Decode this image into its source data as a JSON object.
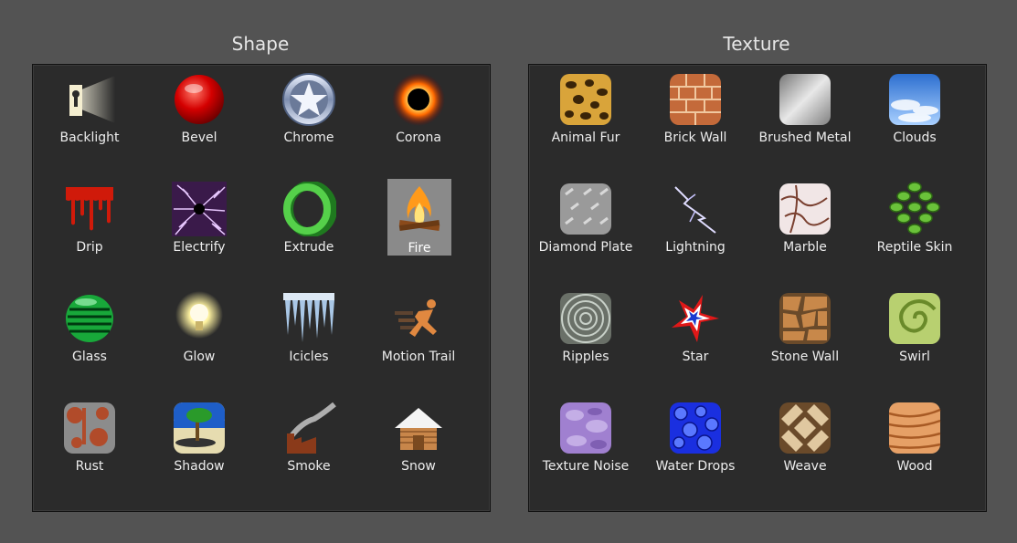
{
  "shape": {
    "title": "Shape",
    "items": [
      {
        "label": "Backlight",
        "icon": "backlight-icon"
      },
      {
        "label": "Bevel",
        "icon": "bevel-icon"
      },
      {
        "label": "Chrome",
        "icon": "chrome-icon"
      },
      {
        "label": "Corona",
        "icon": "corona-icon"
      },
      {
        "label": "Drip",
        "icon": "drip-icon"
      },
      {
        "label": "Electrify",
        "icon": "electrify-icon"
      },
      {
        "label": "Extrude",
        "icon": "extrude-icon"
      },
      {
        "label": "Fire",
        "icon": "fire-icon",
        "selected": true
      },
      {
        "label": "Glass",
        "icon": "glass-icon"
      },
      {
        "label": "Glow",
        "icon": "glow-icon"
      },
      {
        "label": "Icicles",
        "icon": "icicles-icon"
      },
      {
        "label": "Motion Trail",
        "icon": "motion-trail-icon"
      },
      {
        "label": "Rust",
        "icon": "rust-icon"
      },
      {
        "label": "Shadow",
        "icon": "shadow-icon"
      },
      {
        "label": "Smoke",
        "icon": "smoke-icon"
      },
      {
        "label": "Snow",
        "icon": "snow-icon"
      }
    ]
  },
  "texture": {
    "title": "Texture",
    "items": [
      {
        "label": "Animal Fur",
        "icon": "animal-fur-icon"
      },
      {
        "label": "Brick Wall",
        "icon": "brick-wall-icon"
      },
      {
        "label": "Brushed Metal",
        "icon": "brushed-metal-icon"
      },
      {
        "label": "Clouds",
        "icon": "clouds-icon"
      },
      {
        "label": "Diamond Plate",
        "icon": "diamond-plate-icon"
      },
      {
        "label": "Lightning",
        "icon": "lightning-icon"
      },
      {
        "label": "Marble",
        "icon": "marble-icon"
      },
      {
        "label": "Reptile Skin",
        "icon": "reptile-skin-icon"
      },
      {
        "label": "Ripples",
        "icon": "ripples-icon"
      },
      {
        "label": "Star",
        "icon": "star-icon"
      },
      {
        "label": "Stone Wall",
        "icon": "stone-wall-icon"
      },
      {
        "label": "Swirl",
        "icon": "swirl-icon"
      },
      {
        "label": "Texture Noise",
        "icon": "texture-noise-icon"
      },
      {
        "label": "Water Drops",
        "icon": "water-drops-icon"
      },
      {
        "label": "Weave",
        "icon": "weave-icon"
      },
      {
        "label": "Wood",
        "icon": "wood-icon"
      }
    ]
  },
  "colors": {
    "background": "#535353",
    "panel": "#2b2b2b",
    "selected": "#8a8a8a",
    "label": "#ededed"
  }
}
